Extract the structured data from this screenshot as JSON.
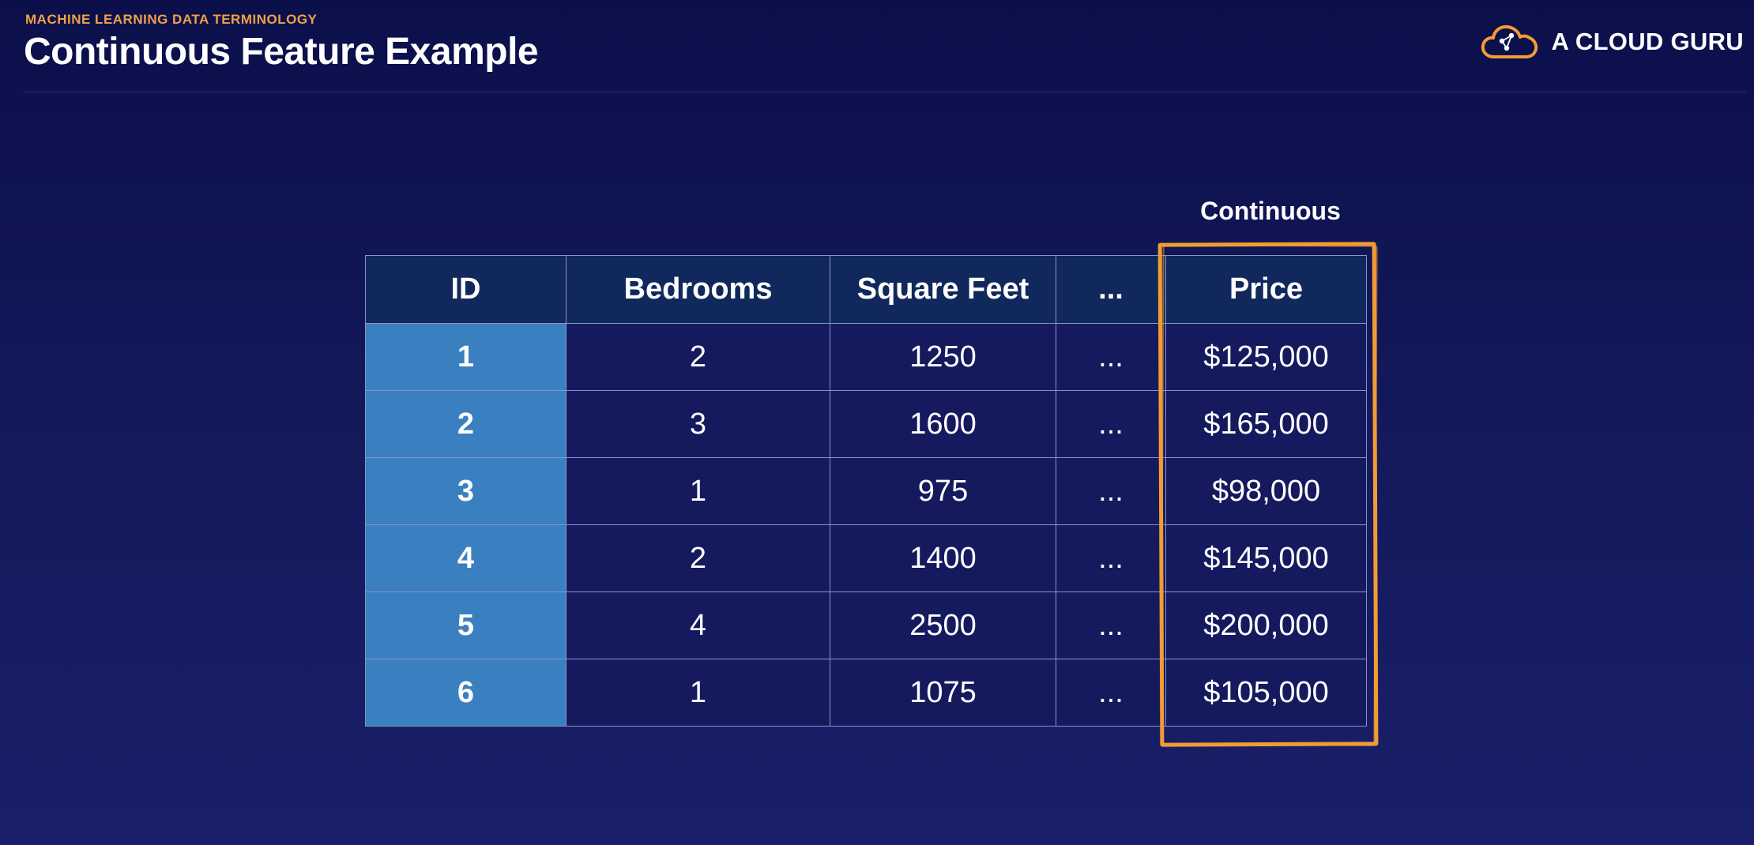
{
  "header": {
    "eyebrow": "MACHINE LEARNING DATA TERMINOLOGY",
    "title": "Continuous Feature Example"
  },
  "brand": {
    "name": "A CLOUD GURU",
    "logo_icon": "cloud-logo-icon"
  },
  "annotation": {
    "label": "Continuous",
    "highlight_color": "#f39c33"
  },
  "table": {
    "headers": {
      "id": "ID",
      "bedrooms": "Bedrooms",
      "square_feet": "Square Feet",
      "ellipsis": "...",
      "price": "Price"
    },
    "rows": [
      {
        "id": "1",
        "bedrooms": "2",
        "square_feet": "1250",
        "ellipsis": "...",
        "price": "$125,000"
      },
      {
        "id": "2",
        "bedrooms": "3",
        "square_feet": "1600",
        "ellipsis": "...",
        "price": "$165,000"
      },
      {
        "id": "3",
        "bedrooms": "1",
        "square_feet": "975",
        "ellipsis": "...",
        "price": "$98,000"
      },
      {
        "id": "4",
        "bedrooms": "2",
        "square_feet": "1400",
        "ellipsis": "...",
        "price": "$145,000"
      },
      {
        "id": "5",
        "bedrooms": "4",
        "square_feet": "2500",
        "ellipsis": "...",
        "price": "$200,000"
      },
      {
        "id": "6",
        "bedrooms": "1",
        "square_feet": "1075",
        "ellipsis": "...",
        "price": "$105,000"
      }
    ]
  },
  "colors": {
    "accent_orange": "#f0a148",
    "id_column": "#3a7fbf",
    "header_row": "#11285c",
    "cell_background": "#151a5e"
  }
}
